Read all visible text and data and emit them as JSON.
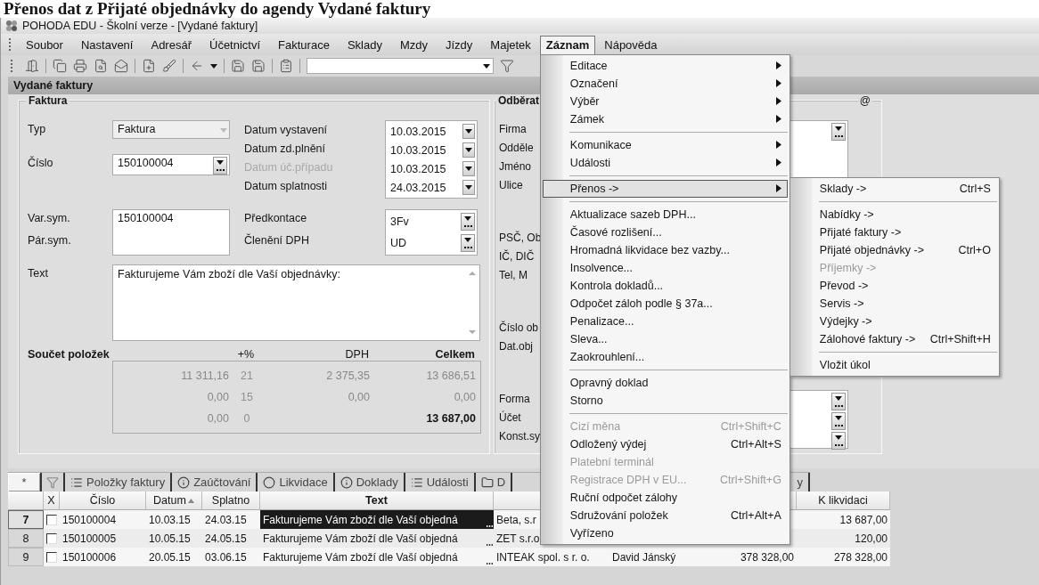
{
  "heading": "Přenos dat z Přijaté objednávky do agendy Vydané faktury",
  "window": {
    "title": "POHODA EDU - Školní verze - [Vydané faktury]"
  },
  "menubar": [
    {
      "label": "Soubor",
      "selected": false
    },
    {
      "label": "Nastavení",
      "selected": false
    },
    {
      "label": "Adresář",
      "selected": false
    },
    {
      "label": "Účetnictví",
      "selected": false
    },
    {
      "label": "Fakturace",
      "selected": false
    },
    {
      "label": "Sklady",
      "selected": false
    },
    {
      "label": "Mzdy",
      "selected": false
    },
    {
      "label": "Jízdy",
      "selected": false
    },
    {
      "label": "Majetek",
      "selected": false
    },
    {
      "label": "Záznam",
      "selected": true
    },
    {
      "label": "Nápověda",
      "selected": false
    }
  ],
  "menu": {
    "items": [
      {
        "kind": "item",
        "label": "Editace",
        "submenu": true,
        "disabled": false,
        "selected": false
      },
      {
        "kind": "item",
        "label": "Označení",
        "submenu": true,
        "disabled": false,
        "selected": false
      },
      {
        "kind": "item",
        "label": "Výběr",
        "submenu": true,
        "disabled": false,
        "selected": false
      },
      {
        "kind": "item",
        "label": "Zámek",
        "submenu": true,
        "disabled": false,
        "selected": false
      },
      {
        "kind": "separator"
      },
      {
        "kind": "item",
        "label": "Komunikace",
        "submenu": true,
        "disabled": false,
        "selected": false
      },
      {
        "kind": "item",
        "label": "Události",
        "submenu": true,
        "disabled": false,
        "selected": false
      },
      {
        "kind": "separator"
      },
      {
        "kind": "item",
        "label": "Přenos ->",
        "submenu": true,
        "disabled": false,
        "selected": true
      },
      {
        "kind": "separator"
      },
      {
        "kind": "item",
        "label": "Aktualizace sazeb DPH...",
        "submenu": false,
        "disabled": false,
        "selected": false
      },
      {
        "kind": "item",
        "label": "Časové rozlišení...",
        "submenu": false,
        "disabled": false,
        "selected": false
      },
      {
        "kind": "item",
        "label": "Hromadná likvidace bez vazby...",
        "submenu": false,
        "disabled": false,
        "selected": false
      },
      {
        "kind": "item",
        "label": "Insolvence...",
        "submenu": false,
        "disabled": false,
        "selected": false
      },
      {
        "kind": "item",
        "label": "Kontrola dokladů...",
        "submenu": false,
        "disabled": false,
        "selected": false
      },
      {
        "kind": "item",
        "label": "Odpočet záloh podle § 37a...",
        "submenu": false,
        "disabled": false,
        "selected": false
      },
      {
        "kind": "item",
        "label": "Penalizace...",
        "submenu": false,
        "disabled": false,
        "selected": false
      },
      {
        "kind": "item",
        "label": "Sleva...",
        "submenu": false,
        "disabled": false,
        "selected": false
      },
      {
        "kind": "item",
        "label": "Zaokrouhlení...",
        "submenu": false,
        "disabled": false,
        "selected": false
      },
      {
        "kind": "separator"
      },
      {
        "kind": "item",
        "label": "Opravný doklad",
        "submenu": false,
        "disabled": false,
        "selected": false
      },
      {
        "kind": "item",
        "label": "Storno",
        "submenu": false,
        "disabled": false,
        "selected": false
      },
      {
        "kind": "separator"
      },
      {
        "kind": "item",
        "label": "Cizí měna",
        "shortcut": "Ctrl+Shift+C",
        "submenu": false,
        "disabled": true,
        "selected": false
      },
      {
        "kind": "item",
        "label": "Odložený výdej",
        "shortcut": "Ctrl+Alt+S",
        "submenu": false,
        "disabled": false,
        "selected": false
      },
      {
        "kind": "item",
        "label": "Platební terminál",
        "submenu": false,
        "disabled": true,
        "selected": false
      },
      {
        "kind": "item",
        "label": "Registrace DPH v EU...",
        "shortcut": "Ctrl+Shift+G",
        "submenu": false,
        "disabled": true,
        "selected": false
      },
      {
        "kind": "item",
        "label": "Ruční odpočet zálohy",
        "submenu": false,
        "disabled": false,
        "selected": false
      },
      {
        "kind": "item",
        "label": "Sdružování položek",
        "shortcut": "Ctrl+Alt+A",
        "submenu": false,
        "disabled": false,
        "selected": false
      },
      {
        "kind": "item",
        "label": "Vyřízeno",
        "submenu": false,
        "disabled": false,
        "selected": false
      }
    ]
  },
  "submenu": {
    "items": [
      {
        "kind": "item",
        "label": "Sklady ->",
        "shortcut": "Ctrl+S",
        "disabled": false
      },
      {
        "kind": "separator"
      },
      {
        "kind": "item",
        "label": "Nabídky ->",
        "disabled": false
      },
      {
        "kind": "item",
        "label": "Přijaté faktury ->",
        "disabled": false
      },
      {
        "kind": "item",
        "label": "Přijaté objednávky ->",
        "shortcut": "Ctrl+O",
        "disabled": false
      },
      {
        "kind": "item",
        "label": "Příjemky ->",
        "disabled": true
      },
      {
        "kind": "item",
        "label": "Převod ->",
        "disabled": false
      },
      {
        "kind": "item",
        "label": "Servis ->",
        "disabled": false
      },
      {
        "kind": "item",
        "label": "Výdejky ->",
        "disabled": false
      },
      {
        "kind": "item",
        "label": "Zálohové faktury ->",
        "shortcut": "Ctrl+Shift+H",
        "disabled": false
      },
      {
        "kind": "separator"
      },
      {
        "kind": "item",
        "label": "Vložit úkol",
        "disabled": false
      }
    ]
  },
  "agenda": {
    "title": "Vydané faktury"
  },
  "invoice": {
    "legend": "Faktura",
    "type": {
      "label": "Typ",
      "value": "Faktura"
    },
    "number": {
      "label": "Číslo",
      "value": "150100004"
    },
    "dates": [
      {
        "label": "Datum vystavení",
        "value": "10.03.2015",
        "disabled": false
      },
      {
        "label": "Datum zd.plnění",
        "value": "10.03.2015",
        "disabled": false
      },
      {
        "label": "Datum úč.případu",
        "value": "10.03.2015",
        "disabled": true
      },
      {
        "label": "Datum splatnosti",
        "value": "24.03.2015",
        "disabled": false
      }
    ],
    "var_sym": {
      "label": "Var.sym.",
      "value": "150100004"
    },
    "par_sym": {
      "label": "Pár.sym."
    },
    "predkontace": {
      "label": "Předkontace",
      "value": "3Fv"
    },
    "cleneni": {
      "label": "Členění DPH",
      "value": "UD"
    },
    "text": {
      "label": "Text",
      "value": "Fakturujeme Vám zboží dle Vaší objednávky:"
    },
    "summary": {
      "title": "Součet položek",
      "headers": [
        "+%",
        "DPH",
        "Celkem"
      ],
      "rows": [
        {
          "base": "11 311,16",
          "rate": "21",
          "vat": "2 375,35",
          "total": "13 686,51",
          "grand": false
        },
        {
          "base": "0,00",
          "rate": "15",
          "vat": "0,00",
          "total": "0,00",
          "grand": false
        },
        {
          "base": "0,00",
          "rate": "0",
          "total": "13 687,00",
          "grand": true
        }
      ]
    }
  },
  "customer": {
    "legend": "Odběrat",
    "mark": "@",
    "groups": [
      {
        "labels": [
          "Firma",
          "Odděle",
          "Jméno",
          "Ulice"
        ]
      },
      {
        "labels": [
          "PSČ, Ob",
          "IČ, DIČ",
          "Tel, M"
        ]
      },
      {
        "labels": [
          "Číslo ob",
          "Dat.obj"
        ]
      },
      {
        "labels": [
          "Forma",
          "Účet",
          "Konst.sy"
        ]
      }
    ]
  },
  "tabs": [
    {
      "label": "*",
      "selected": true
    },
    {
      "label": "Položky faktury",
      "selected": false
    },
    {
      "label": "Zaúčtování",
      "selected": false
    },
    {
      "label": "Likvidace",
      "selected": false
    },
    {
      "label": "Doklady",
      "selected": false
    },
    {
      "label": "Události",
      "selected": false
    },
    {
      "label": "D",
      "selected": false
    },
    {
      "label": "y",
      "selected": false
    }
  ],
  "table": {
    "columns": [
      {
        "label": "X",
        "sorted": false
      },
      {
        "label": "Číslo",
        "sorted": false
      },
      {
        "label": "Datum",
        "sorted": true
      },
      {
        "label": "Splatno",
        "sorted": false
      },
      {
        "label": "Text",
        "sorted": false
      },
      {
        "label": "K likvidaci",
        "sorted": false
      }
    ],
    "rows": [
      {
        "number": "7",
        "selected": true,
        "checked": false,
        "cislo": "150100004",
        "datum": "10.03.15",
        "splatno": "24.03.15",
        "text": "Fakturujeme Vám zboží dle Vaší objedná",
        "firma": "Beta, s.r",
        "k_likvidaci": "13 687,00"
      },
      {
        "number": "8",
        "selected": false,
        "checked": false,
        "cislo": "150100005",
        "datum": "10.05.15",
        "splatno": "24.05.15",
        "text": "Fakturujeme Vám zboží dle Vaší objedná",
        "firma": "ZET s.r.o",
        "k_likvidaci": "120,00"
      },
      {
        "number": "9",
        "selected": false,
        "checked": false,
        "cislo": "150100006",
        "datum": "20.05.15",
        "splatno": "03.06.15",
        "text": "Fakturujeme Vám zboží dle Vaší objedná",
        "firma": "INTEAK spol. s r. o.",
        "kontakt": "David Jánský",
        "celkem": "378 328,00",
        "k_likvidaci": "278 328,00"
      }
    ]
  }
}
